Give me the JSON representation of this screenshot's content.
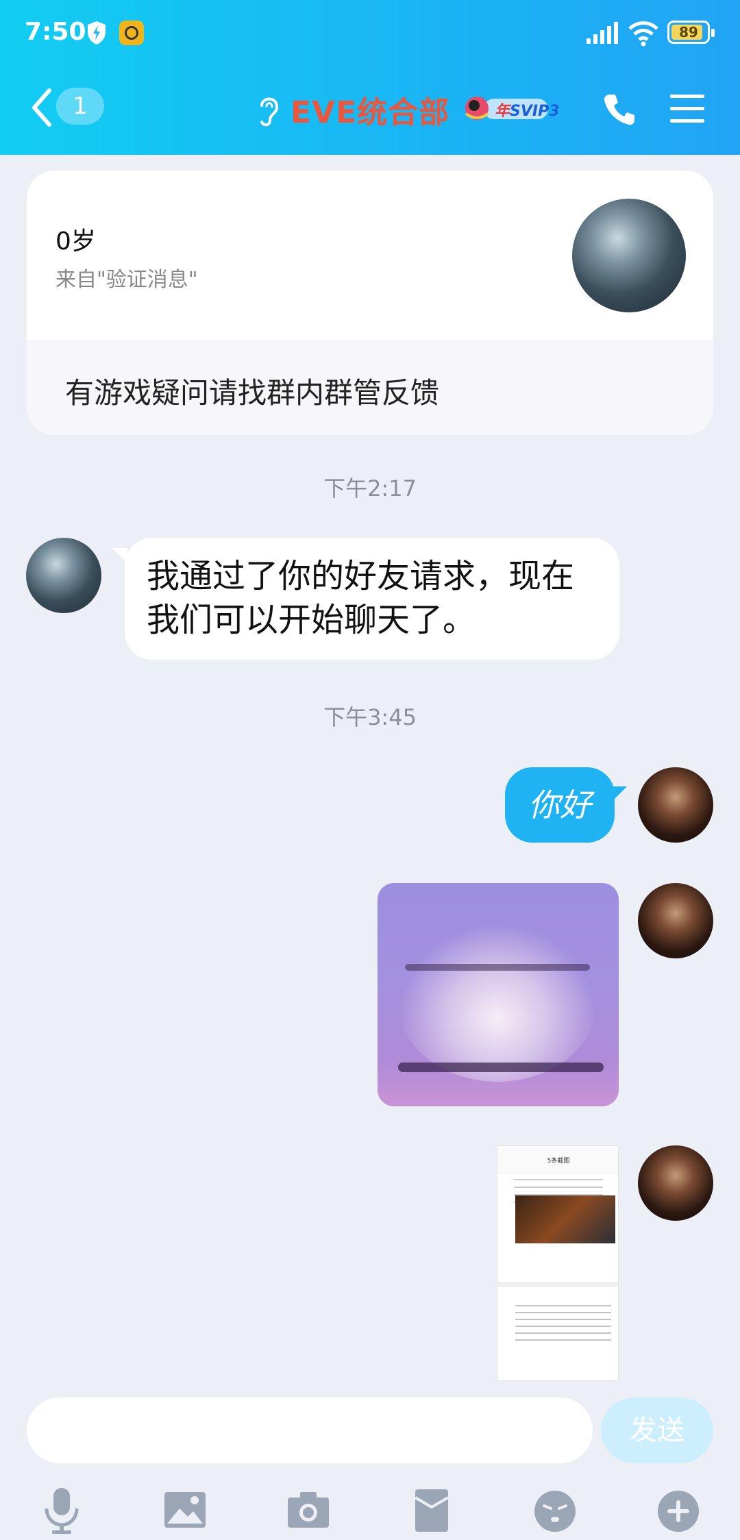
{
  "status_bar": {
    "time": "7:50",
    "battery": "89",
    "battery_level": 0.89
  },
  "header": {
    "unread_count": "1",
    "title": "EVE统合部",
    "badge_prefix": "年",
    "badge_label": "SVIP3"
  },
  "profile_card": {
    "age": "0岁",
    "source": "来自\"验证消息\"",
    "note": "有游戏疑问请找群内群管反馈"
  },
  "messages": {
    "time1": "下午2:17",
    "friend_text": "我通过了你的好友请求，现在我们可以开始聊天了。",
    "time2": "下午3:45",
    "my_text": "你好",
    "screenshot_title": "5条截图"
  },
  "input": {
    "send_label": "发送",
    "placeholder": ""
  },
  "colors": {
    "header_start": "#12cdf2",
    "header_end": "#21a4f5",
    "accent_bubble": "#1fb3f3",
    "title": "#e8573e"
  },
  "icons": [
    "back-icon",
    "ear-icon",
    "svip-badge",
    "phone-icon",
    "menu-icon",
    "mic-icon",
    "image-icon",
    "camera-icon",
    "red-packet-icon",
    "emoji-icon",
    "plus-icon"
  ]
}
